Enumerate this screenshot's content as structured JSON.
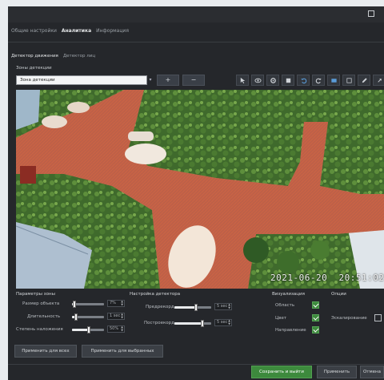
{
  "tabs": [
    {
      "label": "Общие настройки",
      "active": false
    },
    {
      "label": "Аналитика",
      "active": true
    },
    {
      "label": "Информация",
      "active": false
    }
  ],
  "subtabs": [
    {
      "label": "Детектор движения",
      "active": true
    },
    {
      "label": "Детектор лиц",
      "active": false
    }
  ],
  "zones": {
    "label": "Зоны детекции",
    "selected": "Зона детекции",
    "add_label": "+",
    "remove_label": "−"
  },
  "toolbar_icons": [
    "pointer-icon",
    "eye-icon",
    "settings-icon",
    "fill-icon",
    "undo-icon",
    "redo-icon",
    "rect-icon",
    "grid-icon",
    "pencil-icon",
    "expand-icon"
  ],
  "video": {
    "timestamp": "2021-06-20  20:51:02"
  },
  "zone_params": {
    "title": "Параметры зоны",
    "object_size": {
      "label": "Размер объекта",
      "value": "7%",
      "percent": 7
    },
    "duration": {
      "label": "Длительность",
      "value": "1 sec",
      "percent": 10
    },
    "overlap": {
      "label": "Степень наложения",
      "value": "50%",
      "percent": 50
    }
  },
  "detector_settings": {
    "title": "Настройка детектора",
    "threshold": {
      "label": "Предрекорд",
      "value": "5 sec",
      "percent": 55
    },
    "postrecord": {
      "label": "Построекорд",
      "value": "5 sec",
      "percent": 75
    }
  },
  "visualization": {
    "title": "Визуализация",
    "items": [
      {
        "label": "Область",
        "checked": true
      },
      {
        "label": "Цвет",
        "checked": true
      },
      {
        "label": "Направление",
        "checked": true
      }
    ]
  },
  "options": {
    "title": "Опции",
    "items": [
      {
        "label": "Эскалирование",
        "checked": false
      }
    ]
  },
  "actions": {
    "apply_all": "Применить для всех",
    "apply_selected": "Применить для выбранных",
    "save_exit": "Сохранить и выйти",
    "apply": "Применить",
    "cancel": "Отмена"
  },
  "colors": {
    "zone_overlay": "#c23a1e",
    "accent_green": "#3d8a3d",
    "window_bg": "#25272b"
  }
}
